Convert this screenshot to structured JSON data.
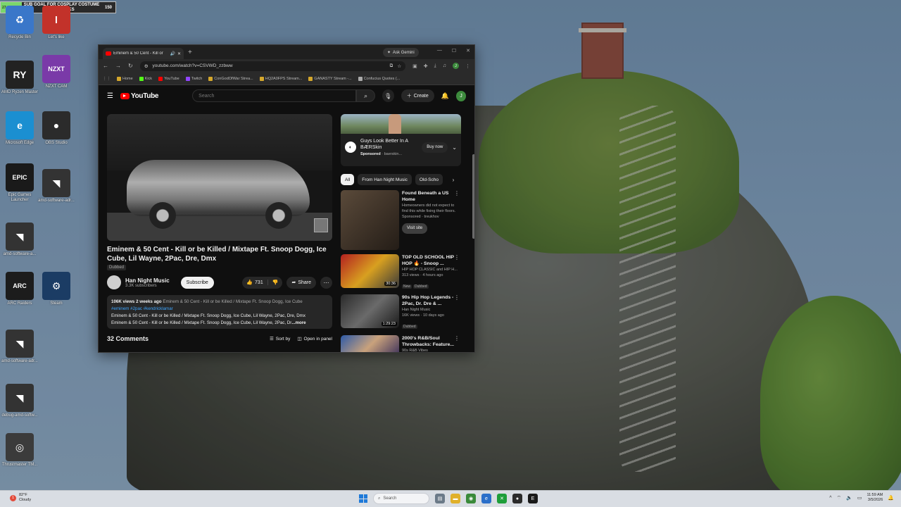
{
  "overlay": {
    "sub_goal_text": "SUB GOAL FOR COSPLAY COSTUME CHAT PICKS",
    "sub_goal_current": "27",
    "sub_goal_target": "150"
  },
  "desktop_icons": [
    {
      "label": "Recycle Bin",
      "glyph": "♻",
      "color": "#3a77c9"
    },
    {
      "label": "Let's like",
      "glyph": "l",
      "color": "#c2322a"
    },
    {
      "label": "AMD Ryzen Master",
      "glyph": "RY",
      "color": "#222"
    },
    {
      "label": "NZXT CAM",
      "glyph": "NZXT",
      "color": "#7a3aa8"
    },
    {
      "label": "Microsoft Edge",
      "glyph": "e",
      "color": "#1b8fd1"
    },
    {
      "label": "OBS Studio",
      "glyph": "●",
      "color": "#2b2b2b"
    },
    {
      "label": "Epic Games Launcher",
      "glyph": "EPIC",
      "color": "#1a1a1a"
    },
    {
      "label": "amd-software-adr...",
      "glyph": "◥",
      "color": "#333"
    },
    {
      "label": "amd-software-a...",
      "glyph": "◥",
      "color": "#333"
    },
    {
      "label": "ARC Raiders",
      "glyph": "ARC",
      "color": "#1c1c1c"
    },
    {
      "label": "Steam",
      "glyph": "⚙",
      "color": "#1b3c64"
    },
    {
      "label": "amd-software-adr...",
      "glyph": "◥",
      "color": "#333"
    },
    {
      "label": "debug-amd-softw...",
      "glyph": "◥",
      "color": "#333"
    },
    {
      "label": "Thrustmaster TM...",
      "glyph": "◎",
      "color": "#3b3b3b"
    }
  ],
  "browser": {
    "tab_title": "Eminem & 50 Cent - Kill or",
    "new_tab": "+",
    "ask_gemini": "Ask Gemini",
    "url": "youtube.com/watch?v=CSVWD_zzbww",
    "bookmarks": [
      {
        "label": "Home",
        "color": "#d4a72c"
      },
      {
        "label": "Kick",
        "color": "#53fc18"
      },
      {
        "label": "YouTube",
        "color": "#ff0000"
      },
      {
        "label": "Twitch",
        "color": "#9146ff"
      },
      {
        "label": "ConGodOfWar Strea...",
        "color": "#d4a72c"
      },
      {
        "label": "HQ2A0FPS Stream...",
        "color": "#d4a72c"
      },
      {
        "label": "GANASTY Stream -...",
        "color": "#d4a72c"
      },
      {
        "label": "Confucius Quotes (...",
        "color": "#aaaaaa"
      }
    ]
  },
  "youtube": {
    "logo": "YouTube",
    "search_placeholder": "Search",
    "create_label": "Create",
    "avatar_letter": "J",
    "video_title": "Eminem & 50 Cent - Kill or be Killed / Mixtape Ft. Snoop Dogg, Ice Cube, Lil Wayne, 2Pac, Dre, Dmx",
    "dubbed_label": "Dubbed",
    "channel_name": "Han Night Music",
    "subscribers": "3.3K subscribers",
    "subscribe_label": "Subscribe",
    "likes": "731",
    "share_label": "Share",
    "desc_views": "106K views",
    "desc_age": "2 weeks ago",
    "desc_title_repeat": "Eminem & 50 Cent - Kill or be Killed / Mixtape Ft. Snoop Dogg, Ice Cube",
    "desc_tags": "#eminem #2pac #kendricklamar",
    "desc_line1": "Eminem & 50 Cent - Kill or be Killed / Mixtape Ft. Snoop Dogg, Ice Cube, Lil Wayne, 2Pac, Dre, Dmx",
    "desc_line2": "Eminem & 50 Cent - Kill or be Killed / Mixtape Ft. Snoop Dogg, Ice Cube, Lil Wayne, 2Pac, Dr",
    "desc_more": "...more",
    "comments_count": "32 Comments",
    "sort_label": "Sort by",
    "open_panel_label": "Open in panel",
    "ad": {
      "title": "Guys Look Better In A BÆRSkin",
      "sponsored": "Sponsored",
      "domain": "baerskin...",
      "button": "Buy now"
    },
    "chips": [
      "All",
      "From Han Night Music",
      "Old-Scho"
    ],
    "recommendations": [
      {
        "title": "Found Beneath a US Home",
        "line1": "Homeowners did not expect to find this while fixing their floors.",
        "line2": "Sponsored · treukhov",
        "action": "Visit site",
        "duration": ""
      },
      {
        "title": "TOP OLD SCHOOL HIP HOP 🔥 - Snoop ...",
        "line1": "HIP HOP CLASSIC and HIP H...",
        "line2": "313 views · 4 hours ago",
        "badge1": "New",
        "badge2": "Dubbed",
        "duration": "30:36"
      },
      {
        "title": "90s Hip Hop Legends - 2Pac, Dr. Dre & ...",
        "line1": "Han Night Music",
        "line2": "16K views · 10 days ago",
        "badge2": "Dubbed",
        "duration": "1:29:23"
      },
      {
        "title": "2000's R&B/Soul Throwbacks: Feature...",
        "line1": "90s R&B Vibes",
        "line2": "",
        "duration": ""
      }
    ]
  },
  "taskbar": {
    "weather_temp": "82°F",
    "weather_desc": "Cloudy",
    "search_placeholder": "Search",
    "time": "11:59 AM",
    "date": "3/5/2026"
  }
}
